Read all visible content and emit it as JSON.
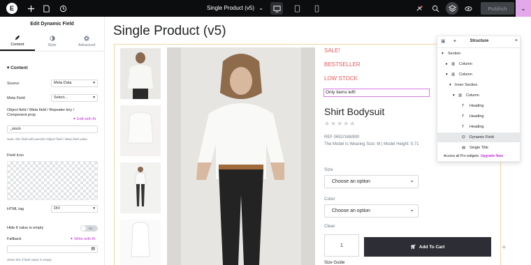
{
  "topbar": {
    "page_title": "Single Product (v5)",
    "publish_label": "Publish",
    "icons": [
      "elementor-logo",
      "add-icon",
      "site-settings-icon",
      "history-icon",
      "desktop-icon",
      "tablet-icon",
      "mobile-icon",
      "notifications-icon",
      "search-icon",
      "structure-icon",
      "preview-icon",
      "chevron-down-icon"
    ]
  },
  "panel": {
    "title": "Edit Dynamic Field",
    "tabs": [
      {
        "label": "Content",
        "icon": "pencil-icon"
      },
      {
        "label": "Style",
        "icon": "half-circle-icon"
      },
      {
        "label": "Advanced",
        "icon": "gear-icon"
      }
    ],
    "section_label": "Content",
    "source_label": "Source",
    "source_value": "Meta Data",
    "meta_field_label": "Meta Field",
    "meta_field_value": "Select...",
    "object_field_label": "Object field / Meta field / Repeater key / Component prop",
    "edit_with_ai": "Edit with AI",
    "object_field_value": "_stock",
    "object_note": "Note: this field will override Object field / Meta field value",
    "field_icon_label": "Field Icon",
    "html_tag_label": "HTML tag",
    "html_tag_value": "DIV",
    "hide_label": "Hide if value is empty",
    "toggle_label": "No",
    "fallback_label": "Fallback",
    "write_with_ai": "Write with AI",
    "fallback_note": "Show this if field value is empty"
  },
  "canvas": {
    "heading": "Single Product (v5)",
    "badges": [
      "SALE!",
      "BESTSELLER",
      "LOW STOCK"
    ],
    "only_items": "Only items left!",
    "product_title": "Shirt Bodysuit",
    "stars": "★★★★★",
    "ref": "REF 0652/168/800",
    "model_info": "The Model Is Wearing Size: M | Model Height: 5.71",
    "size_label": "Size",
    "size_select": "Choose an option",
    "color_label": "Color",
    "color_select": "Choose an option",
    "clear_label": "Clear",
    "qty": "1",
    "cart_label": "Add To Cart",
    "size_guide": "Size Guide"
  },
  "structure": {
    "title": "Structure",
    "items": [
      {
        "label": "Section",
        "icon": "chevron-down-icon"
      },
      {
        "label": "Column",
        "icon": "column-icon"
      },
      {
        "label": "Column",
        "icon": "column-icon"
      },
      {
        "label": "Inner Section",
        "icon": "chevron-down-icon"
      },
      {
        "label": "Column",
        "icon": "column-icon"
      },
      {
        "label": "Heading",
        "icon": "heading-icon"
      },
      {
        "label": "Heading",
        "icon": "heading-icon"
      },
      {
        "label": "Heading",
        "icon": "heading-icon"
      },
      {
        "label": "Dynamic Field",
        "icon": "dynamic-field-icon"
      },
      {
        "label": "Single Title",
        "icon": "title-icon"
      }
    ],
    "footer_text": "Access all Pro widgets.",
    "footer_link": "Upgrade Now"
  },
  "colors": {
    "accent": "#c036d3",
    "sale": "#e45a5a",
    "cart": "#2c2d35",
    "topbar": "#0c0d0e"
  }
}
